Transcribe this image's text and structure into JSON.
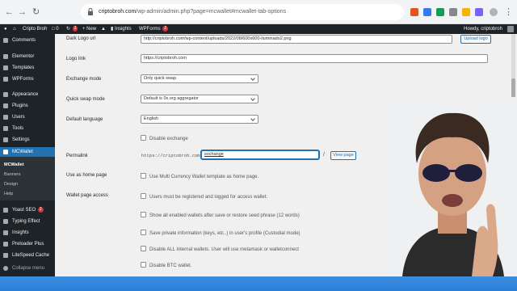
{
  "browser": {
    "url_host": "criptobroh.com",
    "url_path": "/wp-admin/admin.php?page=mcwallet#mcwallet-tab-options"
  },
  "adminbar": {
    "site_name": "Cripto Broh",
    "comments_count": "0",
    "updates_count": "2",
    "new_label": "New",
    "insights_label": "Insights",
    "wpforms_label": "WPForms",
    "wpforms_count": "2",
    "greeting": "Howdy, criptobroh"
  },
  "sidebar": {
    "items": [
      {
        "label": "Comments"
      },
      {
        "label": "Elementor"
      },
      {
        "label": "Templates"
      },
      {
        "label": "WPForms"
      },
      {
        "label": "Appearance"
      },
      {
        "label": "Plugins"
      },
      {
        "label": "Users"
      },
      {
        "label": "Tools"
      },
      {
        "label": "Settings"
      },
      {
        "label": "MCWallet"
      },
      {
        "label": "Yoast SEO",
        "badge": "2"
      },
      {
        "label": "Typing Effect"
      },
      {
        "label": "Insights"
      },
      {
        "label": "Preloader Plus"
      },
      {
        "label": "LiteSpeed Cache"
      },
      {
        "label": "Collapse menu"
      }
    ],
    "submenu": [
      "MCWallet",
      "Banners",
      "Design",
      "Help"
    ]
  },
  "form": {
    "dark_logo": {
      "label": "Dark Logo url",
      "value": "http://criptobroh.com/wp-content/uploads/2022/08/600x600-iluminado2.png",
      "button": "Upload logo"
    },
    "logo_link": {
      "label": "Logo link",
      "value": "https://criptobroh.com"
    },
    "exchange_mode": {
      "label": "Exchange mode",
      "value": "Only quick swap"
    },
    "quick_swap_mode": {
      "label": "Quick swap mode",
      "value": "Default is 0x.org aggregator"
    },
    "default_language": {
      "label": "Default language",
      "value": "English"
    },
    "disable_exchange": "Disable exchange",
    "permalink": {
      "label": "Permalink",
      "prefix": "https://criptobroh.com/",
      "value": "exchange",
      "slash": "/",
      "button": "View page"
    },
    "home_page": {
      "label": "Use as home page",
      "checkbox": "Use Multi Currency Wallet template as home page."
    },
    "wallet_access": {
      "label": "Wallet page access",
      "checkbox": "Users must be registered and logged for access wallet."
    },
    "more_checkboxes": [
      "Show all enabled wallets after save or restore seed phrase (12 words)",
      "Save private information (keys, etc..) in user's profile (Custodial mode)",
      "Disable ALL internal wallets. User will use metamask or walletconnect",
      "Disable BTC wallet."
    ]
  },
  "colors": {
    "admin_dark": "#1d2327",
    "accent": "#2271b1",
    "background": "#f0f0f1",
    "frame_blue": "#2a7fd8"
  }
}
